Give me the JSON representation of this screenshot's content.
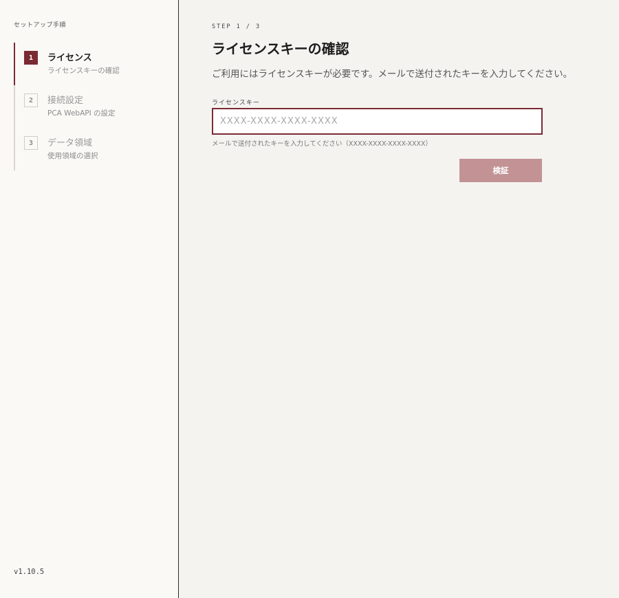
{
  "sidebar": {
    "title": "セットアップ手順",
    "steps": [
      {
        "number": "1",
        "label": "ライセンス",
        "sublabel": "ライセンスキーの確認",
        "active": true
      },
      {
        "number": "2",
        "label": "接続設定",
        "sublabel": "PCA WebAPI の設定",
        "active": false
      },
      {
        "number": "3",
        "label": "データ領域",
        "sublabel": "使用領域の選択",
        "active": false
      }
    ],
    "version": "v1.10.5"
  },
  "main": {
    "step_indicator": "STEP 1 / 3",
    "title": "ライセンスキーの確認",
    "description": "ご利用にはライセンスキーが必要です。メールで送付されたキーを入力してください。",
    "license_field": {
      "label": "ライセンスキー",
      "value": "",
      "placeholder": "XXXX-XXXX-XXXX-XXXX",
      "hint": "メールで送付されたキーを入力してください（XXXX-XXXX-XXXX-XXXX）"
    },
    "verify_label": "検証"
  },
  "colors": {
    "accent": "#7a2a33",
    "button_disabled": "#c29294",
    "sidebar_bg": "#faf9f6",
    "main_bg": "#f4f3f0"
  }
}
